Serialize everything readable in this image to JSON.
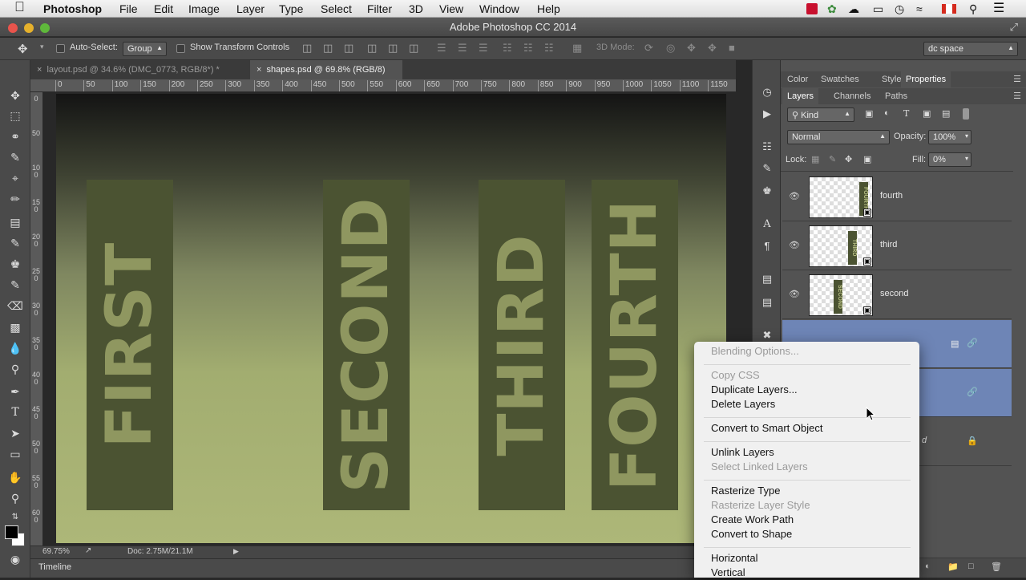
{
  "menubar": {
    "app": "Photoshop",
    "items": [
      "File",
      "Edit",
      "Image",
      "Layer",
      "Type",
      "Select",
      "Filter",
      "3D",
      "View",
      "Window",
      "Help"
    ]
  },
  "window": {
    "title": "Adobe Photoshop CC 2014"
  },
  "options": {
    "auto_select_label": "Auto-Select:",
    "auto_select_value": "Group",
    "show_transform_label": "Show Transform Controls",
    "mode_3d_label": "3D Mode:",
    "workspace": "dc space"
  },
  "tabs": [
    {
      "label": "layout.psd @ 34.6% (DMC_0773, RGB/8*) *",
      "close": "×"
    },
    {
      "label": "shapes.psd @ 69.8% (RGB/8)",
      "close": "×"
    }
  ],
  "ruler": {
    "h_ticks": [
      "0",
      "50",
      "100",
      "150",
      "200",
      "250",
      "300",
      "350",
      "400",
      "450",
      "500",
      "550",
      "600",
      "650",
      "700",
      "750",
      "800",
      "850",
      "900",
      "950",
      "1000",
      "1050",
      "1100",
      "1150"
    ],
    "v_labels": [
      "0",
      "50",
      "100",
      "150",
      "200",
      "250",
      "300",
      "350",
      "400",
      "450",
      "500",
      "550",
      "600"
    ]
  },
  "canvas": {
    "words": [
      "FIRST",
      "SECOND",
      "THIRD",
      "FOURTH"
    ]
  },
  "status": {
    "zoom": "69.75%",
    "doc": "Doc: 2.75M/21.1M"
  },
  "timeline": {
    "label": "Timeline"
  },
  "panel": {
    "top_tabs": [
      "Color",
      "Swatches",
      "Styles",
      "Properties"
    ],
    "layer_tabs": [
      "Layers",
      "Channels",
      "Paths"
    ],
    "filter_kind": "Kind",
    "blend_mode": "Normal",
    "opacity_label": "Opacity:",
    "opacity_value": "100%",
    "lock_label": "Lock:",
    "fill_label": "Fill:",
    "fill_value": "0%",
    "layers": [
      {
        "name": "fourth",
        "thumb_text": "FOURTH"
      },
      {
        "name": "third",
        "thumb_text": "THIRD"
      },
      {
        "name": "second",
        "thumb_text": "SECOND"
      }
    ],
    "partial_text": "d"
  },
  "context_menu": {
    "items": [
      {
        "label": "Blending Options...",
        "enabled": false
      },
      {
        "label": "Copy CSS",
        "enabled": false
      },
      {
        "label": "Duplicate Layers...",
        "enabled": true
      },
      {
        "label": "Delete Layers",
        "enabled": true
      },
      {
        "label": "Convert to Smart Object",
        "enabled": true
      },
      {
        "label": "Unlink Layers",
        "enabled": true
      },
      {
        "label": "Select Linked Layers",
        "enabled": false
      },
      {
        "label": "Rasterize Type",
        "enabled": true
      },
      {
        "label": "Rasterize Layer Style",
        "enabled": false
      },
      {
        "label": "Create Work Path",
        "enabled": true
      },
      {
        "label": "Convert to Shape",
        "enabled": true
      },
      {
        "label": "Horizontal",
        "enabled": true
      },
      {
        "label": "Vertical",
        "enabled": true
      }
    ]
  },
  "colors": {
    "bar": "#4b5332",
    "bar_text": "#8f9760",
    "canvas_top": "#141414",
    "canvas_bottom": "#adb778",
    "selection": "#6e85b6"
  }
}
